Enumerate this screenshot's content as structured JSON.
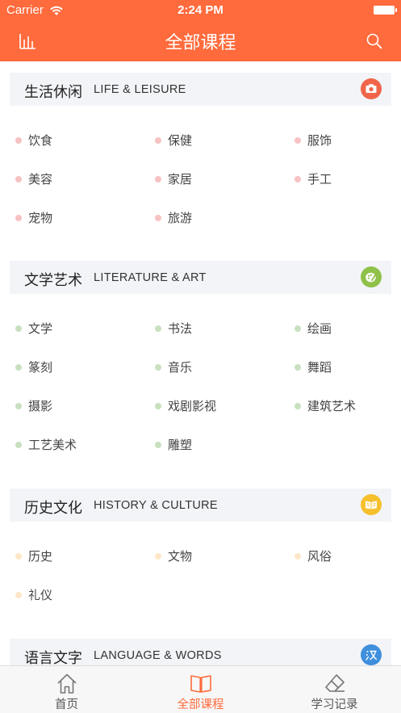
{
  "status_bar": {
    "carrier": "Carrier",
    "time": "2:24 PM"
  },
  "nav": {
    "title": "全部课程",
    "left_icon": "bar-chart-icon",
    "right_icon": "search-icon"
  },
  "colors": {
    "brand": "#ff6b3d",
    "life_dot": "#f7c2c2",
    "literature_dot": "#c8e0c0",
    "history_dot": "#fde7c7",
    "life_icon": "#f0654a",
    "literature_icon": "#8fc14a",
    "history_icon": "#f5c02c",
    "language_icon": "#3f8fdc"
  },
  "sections": [
    {
      "title_cn": "生活休闲",
      "title_en": "LIFE & LEISURE",
      "icon": "camera-icon",
      "items": [
        "饮食",
        "保健",
        "服饰",
        "美容",
        "家居",
        "手工",
        "宠物",
        "旅游"
      ]
    },
    {
      "title_cn": "文学艺术",
      "title_en": "LITERATURE & ART",
      "icon": "palette-icon",
      "items": [
        "文学",
        "书法",
        "绘画",
        "篆刻",
        "音乐",
        "舞蹈",
        "摄影",
        "戏剧影视",
        "建筑艺术",
        "工艺美术",
        "雕塑"
      ]
    },
    {
      "title_cn": "历史文化",
      "title_en": "HISTORY & CULTURE",
      "icon": "book-icon",
      "items": [
        "历史",
        "文物",
        "风俗",
        "礼仪"
      ]
    },
    {
      "title_cn": "语言文字",
      "title_en": "LANGUAGE & WORDS",
      "icon": "language-icon",
      "items": []
    }
  ],
  "tabs": [
    {
      "label": "首页",
      "icon": "home-icon",
      "active": false
    },
    {
      "label": "全部课程",
      "icon": "open-book-icon",
      "active": true
    },
    {
      "label": "学习记录",
      "icon": "eraser-icon",
      "active": false
    }
  ]
}
